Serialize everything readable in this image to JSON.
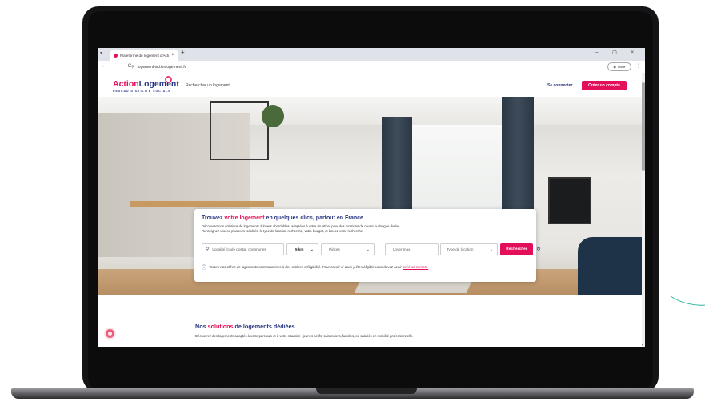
{
  "browser": {
    "tab_title": "Plateforme du logement d'Acti",
    "tab_close": "×",
    "new_tab": "+",
    "window_controls": "–  ▢  ×",
    "nav_buttons": "←  →  C",
    "url": "logement-actionlogement.fr",
    "profile_label": "Invité",
    "menu": "⋮"
  },
  "header": {
    "logo_part1": "Action",
    "logo_part2": "Logement",
    "tagline": "RESEAU D'UTILITE SOCIALE",
    "search_link": "Rechercher un logement",
    "login": "Se connecter",
    "signup": "Créer un compte"
  },
  "search_card": {
    "title_pre": "Trouvez",
    "title_accent": "votre logement",
    "title_post": "en quelques clics, partout en France",
    "description_line1": "Découvrez nos solutions de logements à loyers abordables, adaptées à votre situation, pour des locations de courte ou longue durée.",
    "description_line2": "Renseignez une ou plusieurs localités, le type de location recherché, votre budget, et lancez votre recherche.",
    "location_placeholder": "Localité (code postal, communes",
    "radius": "5 km",
    "rooms_placeholder": "Pièces",
    "rent_placeholder": "Loyer max.",
    "type_placeholder": "Type de location",
    "search_button": "Rechercher",
    "note": "Toutes nos offres de logements sont soumises à des critères d'éligibilité. Pour savoir si vous y êtes éligible vous devez avoir",
    "note_link": "créé un compte."
  },
  "solutions": {
    "title_pre": "Nos",
    "title_accent": "solutions",
    "title_post": "de logements dédiées",
    "description": "Découvrez des logements adaptés à votre parcours et à votre situation : jeunes actifs, saisonniers, familles, ou salariés en mobilité professionnelle."
  },
  "colors": {
    "brand_pink": "#e30f5b",
    "brand_navy": "#283583"
  }
}
